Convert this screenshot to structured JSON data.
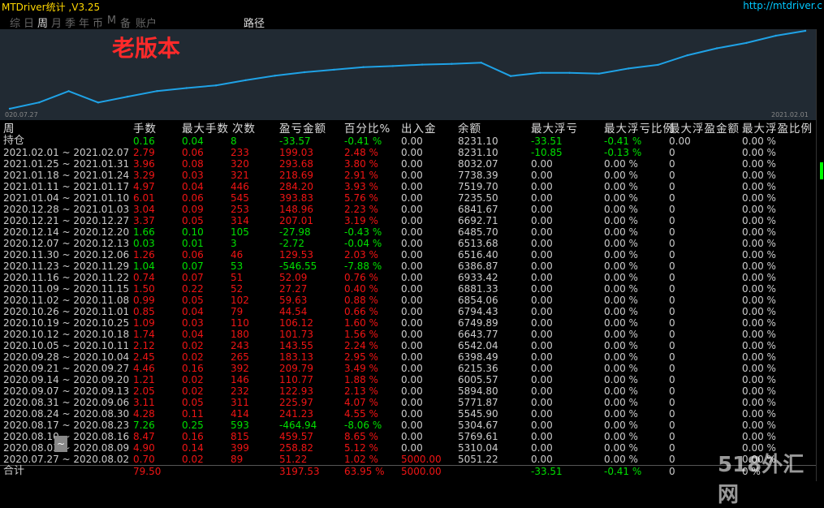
{
  "app": {
    "title": "MTDriver统计 ,V3.25",
    "url": "http://mtdriver.c"
  },
  "tabs": [
    "综",
    "日",
    "周",
    "月",
    "季",
    "年",
    "币",
    "M",
    "备",
    "账户"
  ],
  "active_tab": 2,
  "tab_extra": "路径",
  "annotation": "老版本",
  "chart": {
    "start": "020.07.27",
    "end": "2021.02.01",
    "line_color": "#1fa2e6",
    "values": [
      5051.22,
      5310.04,
      5769.61,
      5304.67,
      5545.9,
      5771.87,
      5894.8,
      6005.57,
      6215.36,
      6398.49,
      6542.04,
      6643.77,
      6749.89,
      6794.43,
      6854.06,
      6881.33,
      6933.42,
      6386.87,
      6516.4,
      6513.68,
      6485.7,
      6692.71,
      6841.67,
      7235.5,
      7519.7,
      7738.39,
      8032.07,
      8231.1
    ]
  },
  "columns": [
    "周",
    "手数",
    "最大手数",
    "次数",
    "盈亏金额",
    "百分比%",
    "出入金",
    "余额",
    "最大浮亏",
    "最大浮亏比例",
    "最大浮盈金额",
    "最大浮盈比例"
  ],
  "position_row": {
    "label": "持仓",
    "lots": "0.16",
    "max_lots": "0.04",
    "count": "8",
    "pl": "-33.57",
    "pct": "-0.41 %",
    "flow": "0.00",
    "balance": "8231.10",
    "max_dd": "-33.51",
    "max_dd_pct": "-0.41 %",
    "max_fp": "0.00",
    "max_fp_pct": "0.00 %"
  },
  "rows": [
    [
      "2021.02.01 ~ 2021.02.07",
      "2.79",
      "0.06",
      "233",
      "199.03",
      "2.48 %",
      "0.00",
      "8231.10",
      "-10.85",
      "-0.13 %",
      "0",
      "0.00 %"
    ],
    [
      "2021.01.25 ~ 2021.01.31",
      "3.96",
      "0.08",
      "320",
      "293.68",
      "3.80 %",
      "0.00",
      "8032.07",
      "0.00",
      "0.00 %",
      "0",
      "0.00 %"
    ],
    [
      "2021.01.18 ~ 2021.01.24",
      "3.29",
      "0.03",
      "321",
      "218.69",
      "2.91 %",
      "0.00",
      "7738.39",
      "0.00",
      "0.00 %",
      "0",
      "0.00 %"
    ],
    [
      "2021.01.11 ~ 2021.01.17",
      "4.97",
      "0.04",
      "446",
      "284.20",
      "3.93 %",
      "0.00",
      "7519.70",
      "0.00",
      "0.00 %",
      "0",
      "0.00 %"
    ],
    [
      "2021.01.04 ~ 2021.01.10",
      "6.01",
      "0.06",
      "545",
      "393.83",
      "5.76 %",
      "0.00",
      "7235.50",
      "0.00",
      "0.00 %",
      "0",
      "0.00 %"
    ],
    [
      "2020.12.28 ~ 2021.01.03",
      "3.04",
      "0.09",
      "253",
      "148.96",
      "2.23 %",
      "0.00",
      "6841.67",
      "0.00",
      "0.00 %",
      "0",
      "0.00 %"
    ],
    [
      "2020.12.21 ~ 2020.12.27",
      "3.37",
      "0.05",
      "314",
      "207.01",
      "3.19 %",
      "0.00",
      "6692.71",
      "0.00",
      "0.00 %",
      "0",
      "0.00 %"
    ],
    [
      "2020.12.14 ~ 2020.12.20",
      "1.66",
      "0.10",
      "105",
      "-27.98",
      "-0.43 %",
      "0.00",
      "6485.70",
      "0.00",
      "0.00 %",
      "0",
      "0.00 %"
    ],
    [
      "2020.12.07 ~ 2020.12.13",
      "0.03",
      "0.01",
      "3",
      "-2.72",
      "-0.04 %",
      "0.00",
      "6513.68",
      "0.00",
      "0.00 %",
      "0",
      "0.00 %"
    ],
    [
      "2020.11.30 ~ 2020.12.06",
      "1.26",
      "0.06",
      "46",
      "129.53",
      "2.03 %",
      "0.00",
      "6516.40",
      "0.00",
      "0.00 %",
      "0",
      "0.00 %"
    ],
    [
      "2020.11.23 ~ 2020.11.29",
      "1.04",
      "0.07",
      "53",
      "-546.55",
      "-7.88 %",
      "0.00",
      "6386.87",
      "0.00",
      "0.00 %",
      "0",
      "0.00 %"
    ],
    [
      "2020.11.16 ~ 2020.11.22",
      "0.74",
      "0.07",
      "51",
      "52.09",
      "0.76 %",
      "0.00",
      "6933.42",
      "0.00",
      "0.00 %",
      "0",
      "0.00 %"
    ],
    [
      "2020.11.09 ~ 2020.11.15",
      "1.50",
      "0.22",
      "52",
      "27.27",
      "0.40 %",
      "0.00",
      "6881.33",
      "0.00",
      "0.00 %",
      "0",
      "0.00 %"
    ],
    [
      "2020.11.02 ~ 2020.11.08",
      "0.99",
      "0.05",
      "102",
      "59.63",
      "0.88 %",
      "0.00",
      "6854.06",
      "0.00",
      "0.00 %",
      "0",
      "0.00 %"
    ],
    [
      "2020.10.26 ~ 2020.11.01",
      "0.85",
      "0.04",
      "79",
      "44.54",
      "0.66 %",
      "0.00",
      "6794.43",
      "0.00",
      "0.00 %",
      "0",
      "0.00 %"
    ],
    [
      "2020.10.19 ~ 2020.10.25",
      "1.09",
      "0.03",
      "110",
      "106.12",
      "1.60 %",
      "0.00",
      "6749.89",
      "0.00",
      "0.00 %",
      "0",
      "0.00 %"
    ],
    [
      "2020.10.12 ~ 2020.10.18",
      "1.74",
      "0.04",
      "180",
      "101.73",
      "1.56 %",
      "0.00",
      "6643.77",
      "0.00",
      "0.00 %",
      "0",
      "0.00 %"
    ],
    [
      "2020.10.05 ~ 2020.10.11",
      "2.12",
      "0.02",
      "243",
      "143.55",
      "2.24 %",
      "0.00",
      "6542.04",
      "0.00",
      "0.00 %",
      "0",
      "0.00 %"
    ],
    [
      "2020.09.28 ~ 2020.10.04",
      "2.45",
      "0.02",
      "265",
      "183.13",
      "2.95 %",
      "0.00",
      "6398.49",
      "0.00",
      "0.00 %",
      "0",
      "0.00 %"
    ],
    [
      "2020.09.21 ~ 2020.09.27",
      "4.46",
      "0.16",
      "392",
      "209.79",
      "3.49 %",
      "0.00",
      "6215.36",
      "0.00",
      "0.00 %",
      "0",
      "0.00 %"
    ],
    [
      "2020.09.14 ~ 2020.09.20",
      "1.21",
      "0.02",
      "146",
      "110.77",
      "1.88 %",
      "0.00",
      "6005.57",
      "0.00",
      "0.00 %",
      "0",
      "0.00 %"
    ],
    [
      "2020.09.07 ~ 2020.09.13",
      "2.05",
      "0.02",
      "232",
      "122.93",
      "2.13 %",
      "0.00",
      "5894.80",
      "0.00",
      "0.00 %",
      "0",
      "0.00 %"
    ],
    [
      "2020.08.31 ~ 2020.09.06",
      "3.11",
      "0.05",
      "311",
      "225.97",
      "4.07 %",
      "0.00",
      "5771.87",
      "0.00",
      "0.00 %",
      "0",
      "0.00 %"
    ],
    [
      "2020.08.24 ~ 2020.08.30",
      "4.28",
      "0.11",
      "414",
      "241.23",
      "4.55 %",
      "0.00",
      "5545.90",
      "0.00",
      "0.00 %",
      "0",
      "0.00 %"
    ],
    [
      "2020.08.17 ~ 2020.08.23",
      "7.26",
      "0.25",
      "593",
      "-464.94",
      "-8.06 %",
      "0.00",
      "5304.67",
      "0.00",
      "0.00 %",
      "0",
      "0.00 %"
    ],
    [
      "2020.08.10 ~ 2020.08.16",
      "8.47",
      "0.16",
      "815",
      "459.57",
      "8.65 %",
      "0.00",
      "5769.61",
      "0.00",
      "0.00 %",
      "0",
      "0.00 %"
    ],
    [
      "2020.08.03 ~ 2020.08.09",
      "4.90",
      "0.14",
      "399",
      "258.82",
      "5.12 %",
      "0.00",
      "5310.04",
      "0.00",
      "0.00 %",
      "0",
      "0.00 %"
    ],
    [
      "2020.07.27 ~ 2020.08.02",
      "0.70",
      "0.02",
      "89",
      "51.22",
      "1.02 %",
      "5000.00",
      "5051.22",
      "0.00",
      "0.00 %",
      "0",
      "0.00 %"
    ]
  ],
  "total_row": {
    "label": "合计",
    "lots": "79.50",
    "pl": "3197.53",
    "pct": "63.95 %",
    "flow": "5000.00",
    "max_dd": "-33.51",
    "max_dd_pct": "-0.41 %",
    "max_fp": "0",
    "max_fp_pct": "0 %"
  },
  "scroll_button": "~",
  "watermark": "518外汇网"
}
